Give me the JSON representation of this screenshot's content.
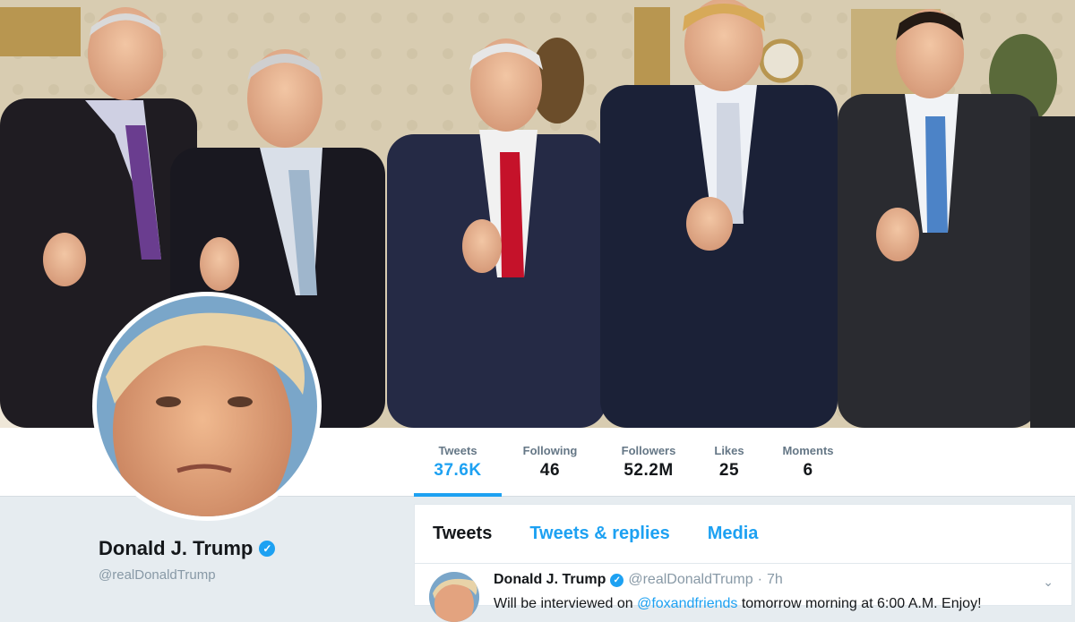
{
  "header": {
    "photo_alt": "Header photo"
  },
  "stats": [
    {
      "label": "Tweets",
      "value": "37.6K",
      "active": true
    },
    {
      "label": "Following",
      "value": "46"
    },
    {
      "label": "Followers",
      "value": "52.2M"
    },
    {
      "label": "Likes",
      "value": "25"
    },
    {
      "label": "Moments",
      "value": "6"
    }
  ],
  "profile": {
    "name": "Donald J. Trump",
    "handle": "@realDonaldTrump",
    "verified_glyph": "✓"
  },
  "timeline": {
    "tabs": [
      {
        "label": "Tweets",
        "active": true
      },
      {
        "label": "Tweets & replies"
      },
      {
        "label": "Media"
      }
    ],
    "tweet": {
      "name": "Donald J. Trump",
      "handle": "@realDonaldTrump",
      "separator": "·",
      "time": "7h",
      "text_before": "Will be interviewed on ",
      "mention": "@foxandfriends",
      "text_after": " tomorrow morning at 6:00 A.M. Enjoy!"
    }
  },
  "icons": {
    "verified": "verified-badge-icon",
    "caret": "chevron-down-icon"
  },
  "colors": {
    "accent": "#1da1f2",
    "text": "#14171a",
    "muted": "#657786",
    "background": "#e6ecf0"
  }
}
